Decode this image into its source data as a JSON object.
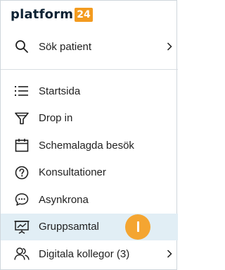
{
  "brand": {
    "name": "platform",
    "badge": "24",
    "badge_color": "#f39b1f"
  },
  "search": {
    "label": "Sök patient",
    "icon": "search-icon",
    "chevron": "chevron-right-icon"
  },
  "nav": {
    "items": [
      {
        "label": "Startsida",
        "icon": "list-icon"
      },
      {
        "label": "Drop in",
        "icon": "funnel-icon"
      },
      {
        "label": "Schemalagda besök",
        "icon": "calendar-icon"
      },
      {
        "label": "Konsultationer",
        "icon": "question-circle-icon"
      },
      {
        "label": "Asynkrona",
        "icon": "chat-bubble-icon"
      },
      {
        "label": "Gruppsamtal",
        "icon": "presentation-icon",
        "active": true
      },
      {
        "label": "Digitala kollegor (3)",
        "icon": "people-icon",
        "chevron": "chevron-right-icon"
      }
    ]
  },
  "colors": {
    "active_bg": "#e1eef5",
    "cursor": "#f4a531",
    "text": "#1f1f1f"
  }
}
